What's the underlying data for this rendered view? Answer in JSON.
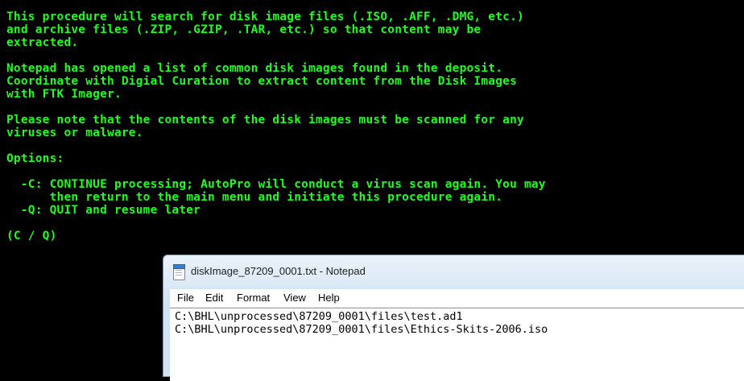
{
  "console": {
    "lines": [
      "This procedure will search for disk image files (.ISO, .AFF, .DMG, etc.)",
      "and archive files (.ZIP, .GZIP, .TAR, etc.) so that content may be",
      "extracted.",
      "Notepad has opened a list of common disk images found in the deposit.",
      "Coordinate with Digial Curation to extract content from the Disk Images",
      "with FTK Imager.",
      "Please note that the contents of the disk images must be scanned for any",
      "viruses or malware.",
      "Options:",
      "  -C: CONTINUE processing; AutoPro will conduct a virus scan again. You may",
      "      then return to the main menu and initiate this procedure again.",
      "  -Q: QUIT and resume later",
      "(C / Q)"
    ]
  },
  "notepad": {
    "title": "diskImage_87209_0001.txt - Notepad",
    "menu": [
      "File",
      "Edit",
      "Format",
      "View",
      "Help"
    ],
    "content_lines": [
      "C:\\BHL\\unprocessed\\87209_0001\\files\\test.ad1",
      "C:\\BHL\\unprocessed\\87209_0001\\files\\Ethics-Skits-2006.iso"
    ]
  },
  "colors": {
    "console_text": "#1cff1c",
    "console_background": "#000000"
  },
  "icons": {
    "notepad_app_icon": "notepad-icon"
  }
}
